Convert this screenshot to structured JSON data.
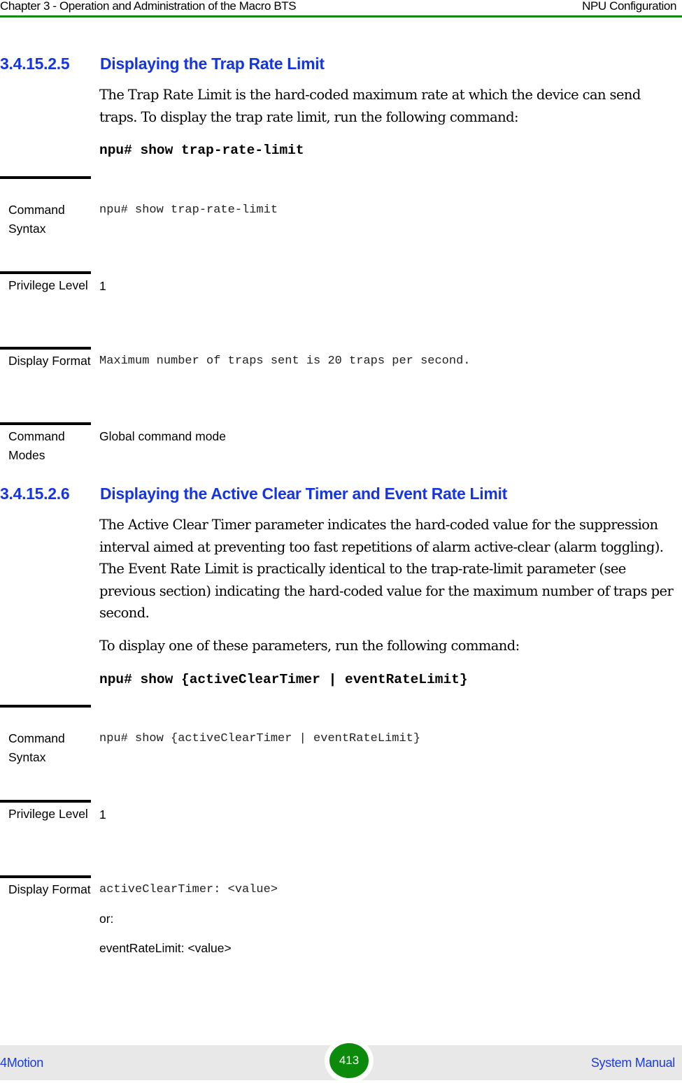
{
  "header": {
    "chapter": "Chapter 3 - Operation and Administration of the Macro BTS",
    "section": "NPU Configuration"
  },
  "sections": [
    {
      "number": "3.4.15.2.5",
      "title": "Displaying the Trap Rate Limit",
      "paragraphs": [
        "The Trap Rate Limit is the hard-coded maximum rate at which the device can send traps. To display the trap rate limit, run the following command:"
      ],
      "command": "npu# show trap-rate-limit",
      "table": [
        {
          "label": "Command Syntax",
          "value": "npu# show trap-rate-limit"
        },
        {
          "label": "Privilege Level",
          "value": "1"
        },
        {
          "label": "Display Format",
          "value": "Maximum number of traps sent is 20 traps per second."
        },
        {
          "label": "Command Modes",
          "value": "Global command mode"
        }
      ]
    },
    {
      "number": "3.4.15.2.6",
      "title": "Displaying the Active Clear Timer and Event Rate Limit",
      "paragraphs": [
        "The Active Clear Timer parameter indicates the hard-coded value for the suppression interval aimed at preventing too fast repetitions of alarm active-clear (alarm toggling). The Event Rate Limit is practically identical to the trap-rate-limit parameter (see previous section) indicating the hard-coded value for the maximum number of traps per second.",
        "To display one of these parameters, run the following command:"
      ],
      "command": "npu# show {activeClearTimer | eventRateLimit}",
      "table": [
        {
          "label": "Command Syntax",
          "value": "npu# show {activeClearTimer | eventRateLimit}"
        },
        {
          "label": "Privilege Level",
          "value": "1"
        },
        {
          "label": "Display Format",
          "value": "activeClearTimer: <value>",
          "value2": "or:",
          "value3": "eventRateLimit: <value>"
        }
      ]
    }
  ],
  "footer": {
    "product": "4Motion",
    "page_number": "413",
    "manual": "System Manual"
  }
}
